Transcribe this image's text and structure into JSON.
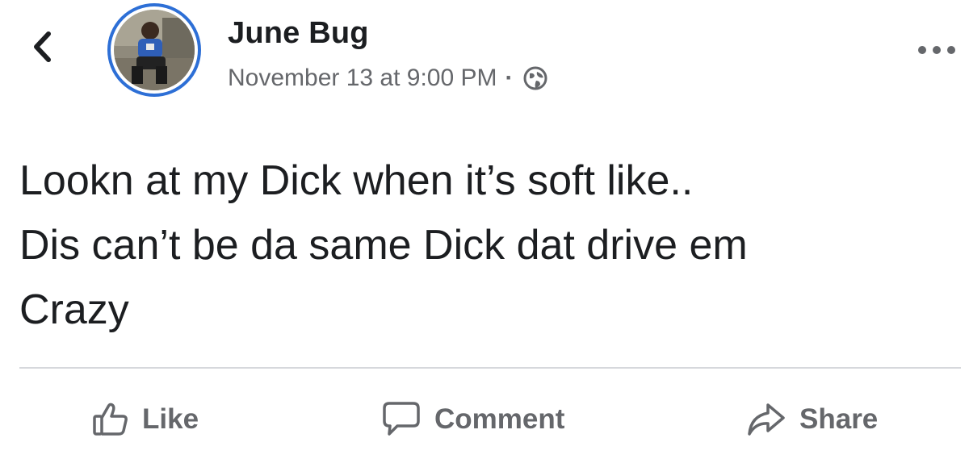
{
  "header": {
    "back_icon": "chevron-left-icon",
    "author": {
      "name": "June Bug",
      "avatar": "profile-photo"
    },
    "timestamp": "November 13 at 9:00 PM",
    "separator": "·",
    "audience_icon": "globe-icon",
    "more_icon": "more-horizontal-icon"
  },
  "post": {
    "text": "Lookn at my Dick when it’s soft like..\nDis can’t be da same Dick dat drive em\nCrazy"
  },
  "actions": {
    "like": {
      "label": "Like",
      "icon": "thumbs-up-icon"
    },
    "comment": {
      "label": "Comment",
      "icon": "comment-bubble-icon"
    },
    "share": {
      "label": "Share",
      "icon": "share-arrow-icon"
    }
  },
  "colors": {
    "text_primary": "#1c1e21",
    "text_secondary": "#65676b",
    "avatar_ring": "#2d6fd6",
    "divider": "#d6d8dc"
  }
}
